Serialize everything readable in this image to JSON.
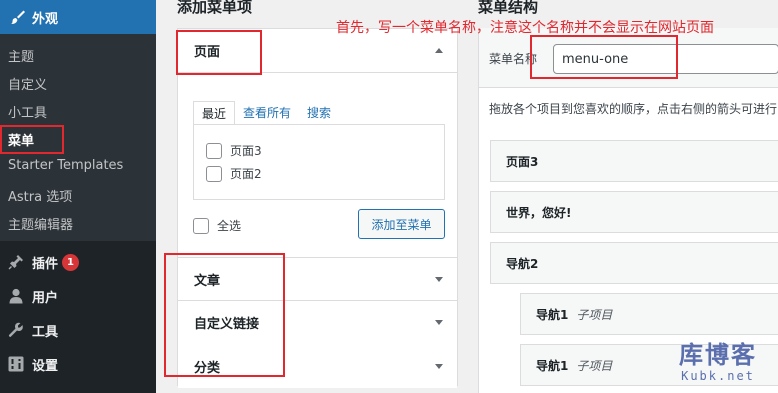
{
  "sidebar": {
    "appearance": {
      "label": "外观",
      "icon": "paintbrush-icon"
    },
    "submenu": [
      "主题",
      "自定义",
      "小工具",
      "菜单",
      "Starter Templates",
      "Astra 选项",
      "主题编辑器"
    ],
    "current_index": 3,
    "main_items": [
      {
        "label": "插件",
        "icon": "plugin-icon",
        "badge": "1"
      },
      {
        "label": "用户",
        "icon": "user-icon"
      },
      {
        "label": "工具",
        "icon": "wrench-icon"
      },
      {
        "label": "设置",
        "icon": "settings-icon"
      }
    ]
  },
  "add_items": {
    "title": "添加菜单项",
    "pages": {
      "label": "页面",
      "tabs": [
        "最近",
        "查看所有",
        "搜索"
      ],
      "items": [
        "页面3",
        "页面2"
      ],
      "select_all": "全选",
      "add_button": "添加至菜单"
    },
    "sections": [
      "文章",
      "自定义链接",
      "分类"
    ]
  },
  "structure": {
    "title": "菜单结构",
    "name_label": "菜单名称",
    "name_value": "menu-one",
    "instructions": "拖放各个项目到您喜欢的顺序，点击右侧的箭头可进行",
    "items": [
      {
        "label": "页面3",
        "sub": ""
      },
      {
        "label": "世界，您好!",
        "sub": ""
      },
      {
        "label": "导航2",
        "sub": ""
      },
      {
        "label": "导航1",
        "sub": "子项目"
      },
      {
        "label": "导航1",
        "sub": "子项目"
      }
    ]
  },
  "annotation": "首先，写一个菜单名称，注意这个名称并不会显示在网站页面",
  "watermark": {
    "cn": "库博客",
    "en": "Kubk.net"
  },
  "colors": {
    "admin_blue": "#2271b1",
    "sidebar_bg": "#1d2327",
    "annotation_red": "#e0282e",
    "badge_red": "#d63638"
  }
}
